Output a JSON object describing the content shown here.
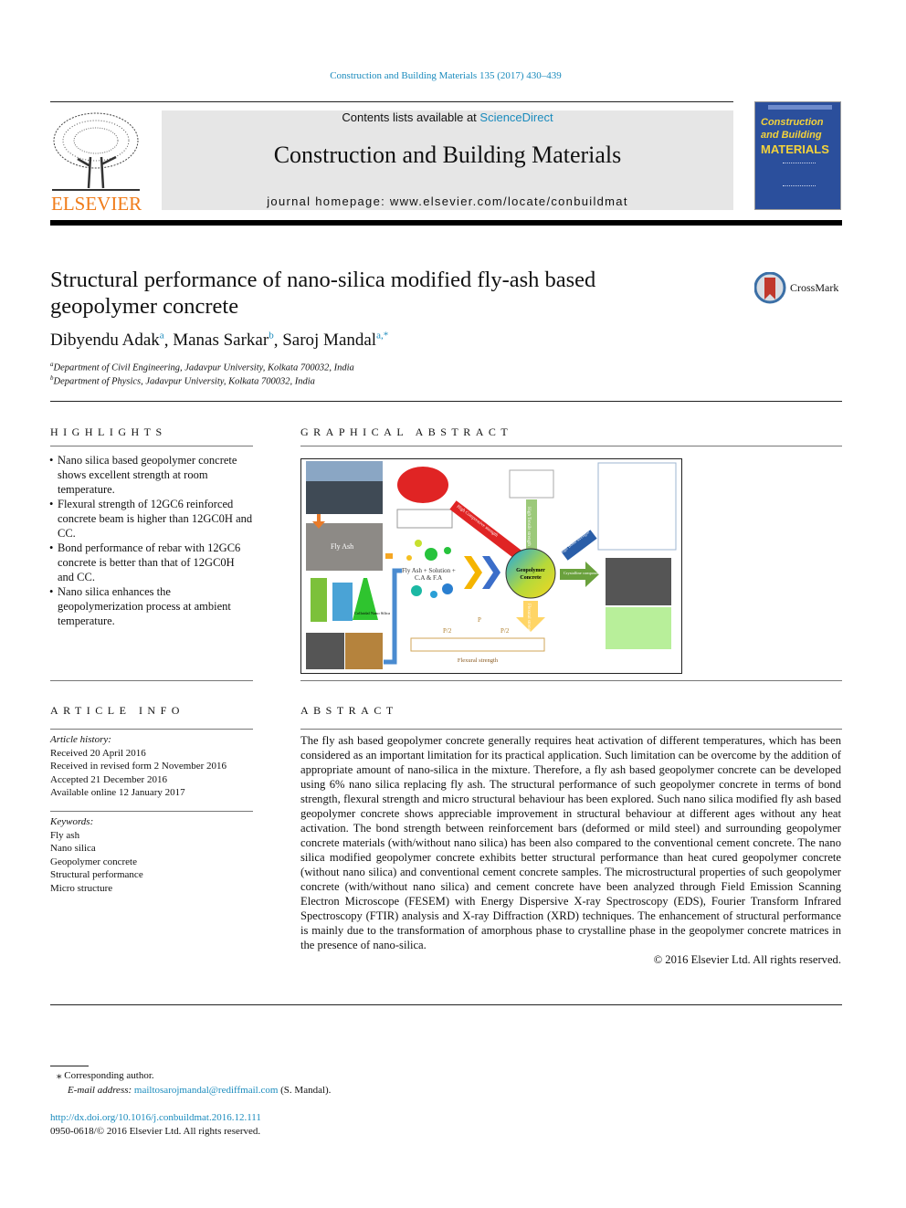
{
  "header": {
    "journal_ref": "Construction and Building Materials 135 (2017) 430–439",
    "contents_prefix": "Contents lists available at ",
    "contents_link": "ScienceDirect",
    "journal_title": "Construction and Building Materials",
    "homepage": "journal homepage: www.elsevier.com/locate/conbuildmat",
    "publisher_logo": "ELSEVIER",
    "cover_title": [
      "Construction",
      "and Building",
      "MATERIALS"
    ]
  },
  "article": {
    "title_line1": "Structural performance of nano-silica modified fly-ash based",
    "title_line2": "geopolymer concrete",
    "crossmark": "CrossMark",
    "authors": [
      {
        "name": "Dibyendu Adak",
        "sup": "a"
      },
      {
        "name": "Manas Sarkar",
        "sup": "b"
      },
      {
        "name": "Saroj Mandal",
        "sup": "a,*"
      }
    ],
    "affiliations": [
      {
        "mark": "a",
        "text": "Department of Civil Engineering, Jadavpur University, Kolkata 700032, India"
      },
      {
        "mark": "b",
        "text": "Department of Physics, Jadavpur University, Kolkata 700032, India"
      }
    ]
  },
  "highlights": {
    "heading": "HIGHLIGHTS",
    "items": [
      "Nano silica based geopolymer concrete shows excellent strength at room temperature.",
      "Flexural strength of 12GC6 reinforced concrete beam is higher than 12GC0H and CC.",
      "Bond performance of rebar with 12GC6 concrete is better than that of 12GC0H and CC.",
      "Nano silica enhances the geopolymerization process at ambient temperature."
    ]
  },
  "graphical_abstract": {
    "heading": "GRAPHICAL ABSTRACT",
    "labels": {
      "fly_ash": "Fly Ash",
      "mix": "Fly Ash + Solution +",
      "mix2": "C.A & F.A",
      "center": "Geopolymer",
      "center2": "Concrete",
      "compressive": "High Compressive strength",
      "tensile": "High Tensile strength",
      "bond": "High Bond strength",
      "crystalline": "Crystalline compound",
      "flexural_arrow": "Flexural strength",
      "flexural": "Flexural strength",
      "load": "P",
      "half_load": "P/2",
      "colloidal": "Colloidal Nano Silica"
    }
  },
  "article_info": {
    "heading": "ARTICLE INFO",
    "history_label": "Article history:",
    "history": [
      "Received 20 April 2016",
      "Received in revised form 2 November 2016",
      "Accepted 21 December 2016",
      "Available online 12 January 2017"
    ],
    "keywords_label": "Keywords:",
    "keywords": [
      "Fly ash",
      "Nano silica",
      "Geopolymer concrete",
      "Structural performance",
      "Micro structure"
    ]
  },
  "abstract": {
    "heading": "ABSTRACT",
    "text": "The fly ash based geopolymer concrete generally requires heat activation of different temperatures, which has been considered as an important limitation for its practical application. Such limitation can be overcome by the addition of appropriate amount of nano-silica in the mixture. Therefore, a fly ash based geopolymer concrete can be developed using 6% nano silica replacing fly ash. The structural per­formance of such geopolymer concrete in terms of bond strength, flexural strength and micro structural behaviour has been explored. Such nano silica modified fly ash based geopolymer concrete shows appre­ciable improvement in structural behaviour at different ages without any heat activation. The bond strength between reinforcement bars (deformed or mild steel) and surrounding geopolymer concrete materials (with/without nano silica) has been also compared to the conventional cement concrete. The nano silica modified geopolymer concrete exhibits better structural performance than heat cured geopolymer concrete (without nano silica) and conventional cement concrete samples. The microstruc­tural properties of such geopolymer concrete (with/without nano silica) and cement concrete have been analyzed through Field Emission Scanning Electron Microscope (FESEM) with Energy Dispersive X-ray Spectroscopy (EDS), Fourier Transform Infrared Spectroscopy (FTIR) analysis and X-ray Diffraction (XRD) techniques. The enhancement of structural performance is mainly due to the transformation of amorphous phase to crystalline phase in the geopolymer concrete matrices in the presence of nano-silica.",
    "copyright": "© 2016 Elsevier Ltd. All rights reserved."
  },
  "footnotes": {
    "corresponding": "⁎ Corresponding author.",
    "email_label": "E-mail address: ",
    "email": "mailtosarojmandal@rediffmail.com",
    "email_suffix": " (S. Mandal).",
    "doi": "http://dx.doi.org/10.1016/j.conbuildmat.2016.12.111",
    "issn": "0950-0618/© 2016 Elsevier Ltd. All rights reserved."
  },
  "colors": {
    "link": "#1a8bbd",
    "elsevier": "#f07c1a",
    "cover": "#2b4f9c"
  }
}
